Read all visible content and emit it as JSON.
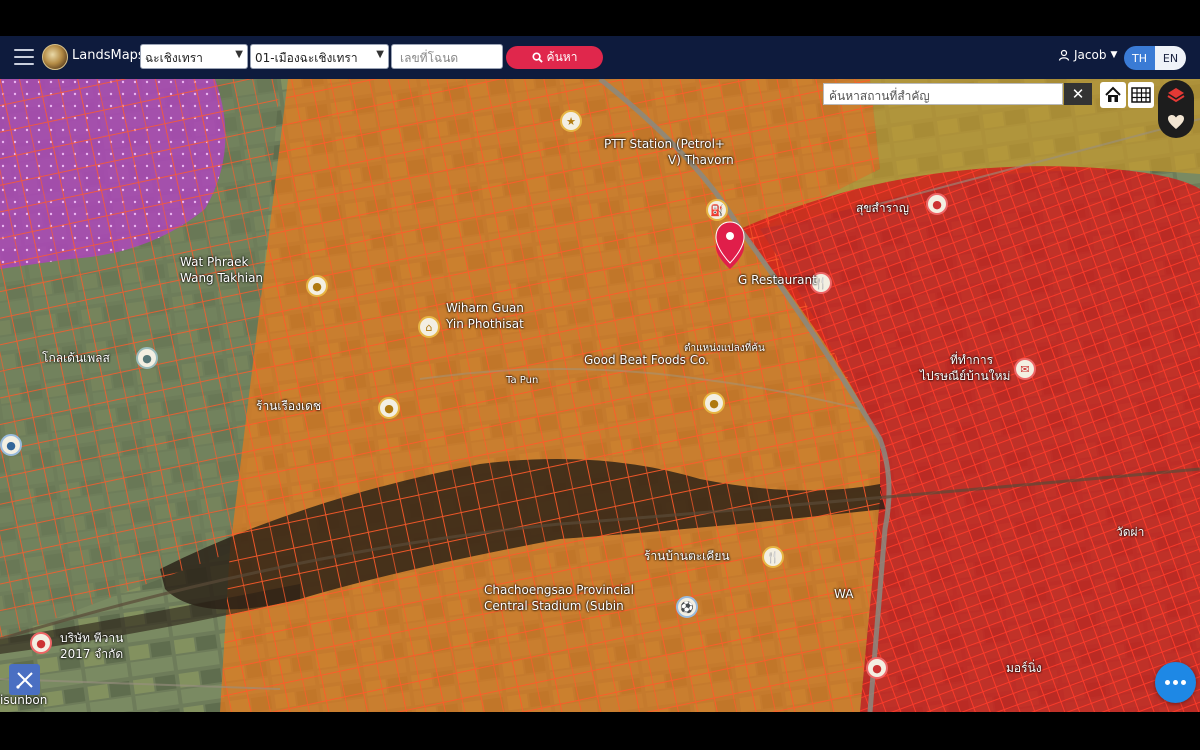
{
  "app": {
    "brand": "LandsMaps"
  },
  "header": {
    "province_select": "ฉะเชิงเทรา",
    "district_select": "01-เมืองฉะเชิงเทรา",
    "deed_placeholder": "เลขที่โฉนด",
    "search_label": "ค้นหา",
    "user_name": "Jacob",
    "lang_th": "TH",
    "lang_en": "EN"
  },
  "map": {
    "place_search_placeholder": "ค้นหาสถานที่สำคัญ",
    "clear_label": "✕",
    "pin_label": "ตำแหน่งแปลงที่ค้น",
    "labels": [
      {
        "id": "wangtakhian",
        "text": "Wat Phraek"
      },
      {
        "id": "wangtakhian2",
        "text": "Wang Takhian"
      },
      {
        "id": "wiharn",
        "text": "Wiharn Guan"
      },
      {
        "id": "yin",
        "text": "Yin Phothisat"
      },
      {
        "id": "ptt",
        "text": "PTT Station (Petrol+"
      },
      {
        "id": "thavorn",
        "text": "V) Thavorn"
      },
      {
        "id": "restaurant",
        "text": "G Restaurant"
      },
      {
        "id": "goodbeat",
        "text": "Good Beat Foods Co."
      },
      {
        "id": "tapun",
        "text": "Ta Pun"
      },
      {
        "id": "stadium",
        "text": "Chachoengsao Provincial"
      },
      {
        "id": "stadium2",
        "text": "Central Stadium (Subin"
      },
      {
        "id": "sunbon",
        "text": "isunbon"
      },
      {
        "id": "wa",
        "text": "WA"
      },
      {
        "id": "thaitext1",
        "text": "โกลเด้นเพลส"
      },
      {
        "id": "thaitext2",
        "text": "สุขสำราญ"
      },
      {
        "id": "thaitext3",
        "text": "ที่ทำการ"
      },
      {
        "id": "thaitext4",
        "text": "ไปรษณีย์บ้านใหม่"
      },
      {
        "id": "thaitext5",
        "text": "บริษัท พีวาน"
      },
      {
        "id": "thaitext6",
        "text": "2017 จำกัด"
      },
      {
        "id": "thaitext7",
        "text": "ร้านเรืองเดช"
      },
      {
        "id": "thaitext8",
        "text": "ร้านบ้านตะเคียน"
      },
      {
        "id": "thaitext9",
        "text": "มอร์นิ่ง"
      },
      {
        "id": "thaitext10",
        "text": "วัดผ่า"
      }
    ]
  },
  "colors": {
    "header_bg": "#0e1b3d",
    "search_btn": "#e0274c",
    "zone_orange": "#e87a1c",
    "zone_red": "#d11a1a",
    "zone_purple": "#b53fc7",
    "parcel_line": "#ff5a2a"
  },
  "icons": {
    "menu": "hamburger-icon",
    "search": "magnifier-icon",
    "user": "user-icon",
    "home": "home-icon",
    "grid": "grid-icon",
    "layers": "layers-icon",
    "favorite": "heart-icon",
    "measure": "ruler-icon",
    "chat": "more-dots-icon",
    "pin": "location-pin-icon"
  }
}
